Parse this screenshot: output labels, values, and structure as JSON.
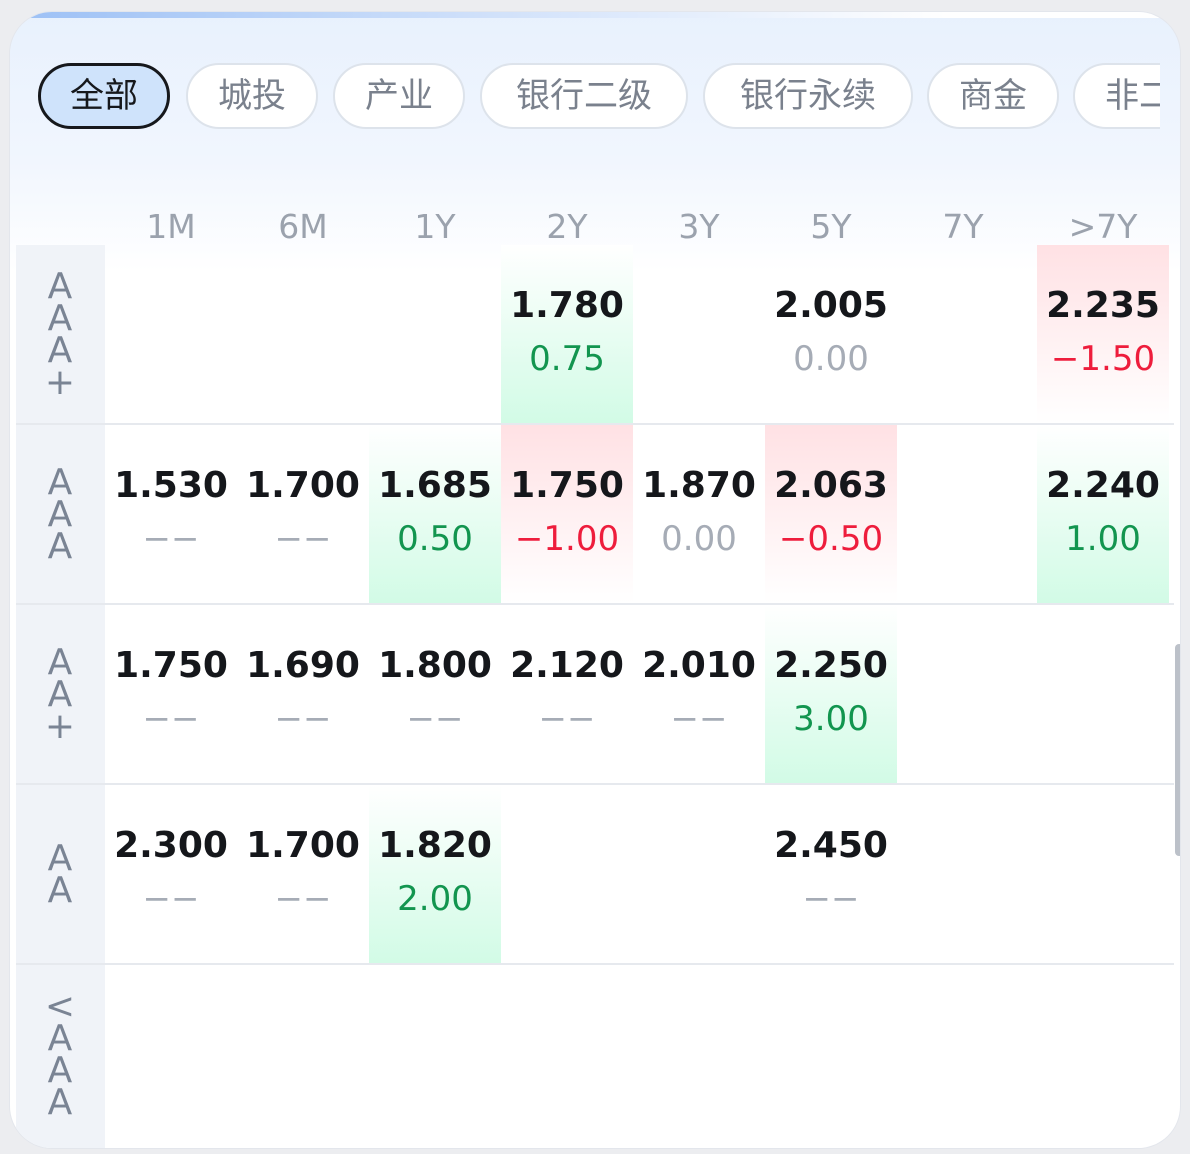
{
  "tabs": [
    {
      "label": "全部",
      "active": true
    },
    {
      "label": "城投",
      "active": false
    },
    {
      "label": "产业",
      "active": false
    },
    {
      "label": "银行二级",
      "active": false
    },
    {
      "label": "银行永续",
      "active": false
    },
    {
      "label": "商金",
      "active": false
    },
    {
      "label": "非二",
      "active": false
    }
  ],
  "columns": [
    "1M",
    "6M",
    "1Y",
    "2Y",
    "3Y",
    "5Y",
    "7Y",
    ">7Y"
  ],
  "rows": [
    {
      "label": [
        "A",
        "A",
        "A",
        "+"
      ],
      "cells": [
        null,
        null,
        null,
        {
          "value": "1.780",
          "change": "0.75",
          "trend": "up"
        },
        null,
        {
          "value": "2.005",
          "change": "0.00",
          "trend": "flat"
        },
        null,
        {
          "value": "2.235",
          "change": "−1.50",
          "trend": "down"
        }
      ]
    },
    {
      "label": [
        "A",
        "A",
        "A"
      ],
      "cells": [
        {
          "value": "1.530",
          "change": "−−",
          "trend": "none"
        },
        {
          "value": "1.700",
          "change": "−−",
          "trend": "none"
        },
        {
          "value": "1.685",
          "change": "0.50",
          "trend": "up"
        },
        {
          "value": "1.750",
          "change": "−1.00",
          "trend": "down"
        },
        {
          "value": "1.870",
          "change": "0.00",
          "trend": "flat"
        },
        {
          "value": "2.063",
          "change": "−0.50",
          "trend": "down"
        },
        null,
        {
          "value": "2.240",
          "change": "1.00",
          "trend": "up"
        }
      ]
    },
    {
      "label": [
        "A",
        "A",
        "+"
      ],
      "cells": [
        {
          "value": "1.750",
          "change": "−−",
          "trend": "none"
        },
        {
          "value": "1.690",
          "change": "−−",
          "trend": "none"
        },
        {
          "value": "1.800",
          "change": "−−",
          "trend": "none"
        },
        {
          "value": "2.120",
          "change": "−−",
          "trend": "none"
        },
        {
          "value": "2.010",
          "change": "−−",
          "trend": "none"
        },
        {
          "value": "2.250",
          "change": "3.00",
          "trend": "up"
        },
        null,
        null
      ]
    },
    {
      "label": [
        "A",
        "A"
      ],
      "cells": [
        {
          "value": "2.300",
          "change": "−−",
          "trend": "none"
        },
        {
          "value": "1.700",
          "change": "−−",
          "trend": "none"
        },
        {
          "value": "1.820",
          "change": "2.00",
          "trend": "up"
        },
        null,
        null,
        {
          "value": "2.450",
          "change": "−−",
          "trend": "none"
        },
        null,
        null
      ]
    },
    {
      "label": [
        "<",
        "A",
        "A",
        "A"
      ],
      "cells": [
        null,
        null,
        null,
        null,
        null,
        null,
        null,
        null
      ]
    }
  ]
}
